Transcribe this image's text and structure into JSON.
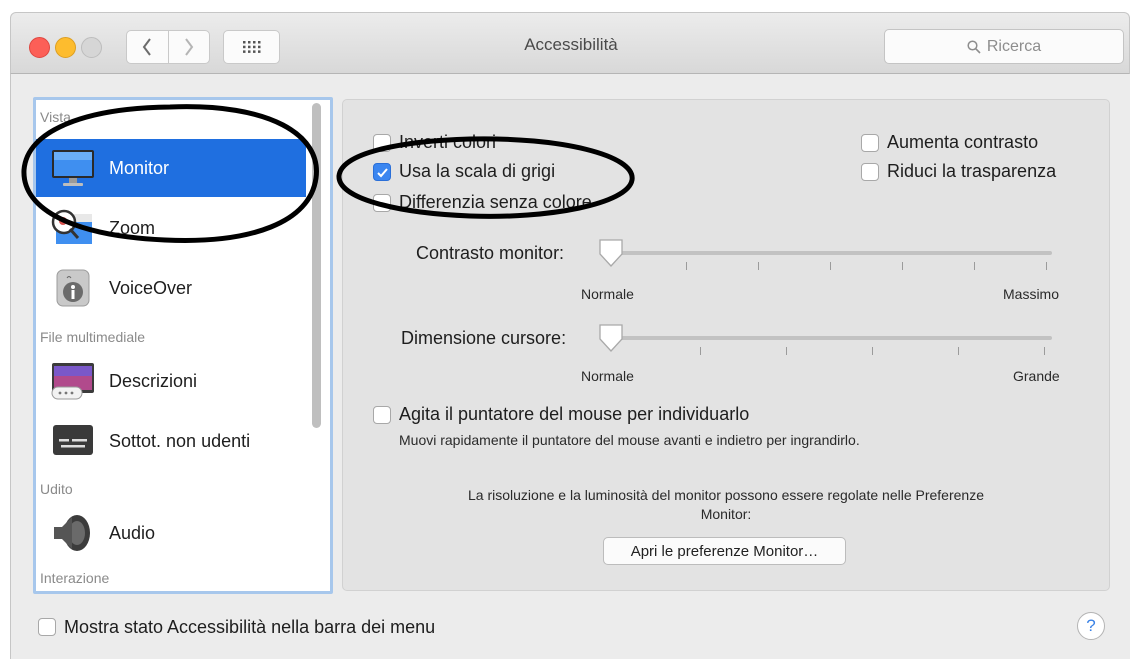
{
  "window": {
    "title": "Accessibilità"
  },
  "toolbar": {
    "search_placeholder": "Ricerca",
    "back_icon": "chevron-left-icon",
    "forward_icon": "chevron-right-icon",
    "grid_icon": "show-all-grid-icon"
  },
  "sidebar": {
    "sections": {
      "vista": "Vista",
      "media": "File multimediale",
      "udito": "Udito",
      "interazione": "Interazione"
    },
    "items": [
      {
        "label": "Monitor",
        "icon": "monitor-icon",
        "selected": true
      },
      {
        "label": "Zoom",
        "icon": "zoom-icon",
        "selected": false
      },
      {
        "label": "VoiceOver",
        "icon": "voiceover-icon",
        "selected": false
      },
      {
        "label": "Descrizioni",
        "icon": "descriptions-icon",
        "selected": false
      },
      {
        "label": "Sottot. non udenti",
        "icon": "captions-icon",
        "selected": false
      },
      {
        "label": "Audio",
        "icon": "speaker-icon",
        "selected": false
      }
    ]
  },
  "main": {
    "checkboxes": {
      "invert": {
        "label": "Inverti colori",
        "checked": false
      },
      "grayscale": {
        "label": "Usa la scala di grigi",
        "checked": true
      },
      "differentiate": {
        "label": "Differenzia senza colore",
        "checked": false
      },
      "contrast": {
        "label": "Aumenta contrasto",
        "checked": false
      },
      "transparency": {
        "label": "Riduci la trasparenza",
        "checked": false
      }
    },
    "contrast_slider": {
      "label": "Contrasto monitor:",
      "min_label": "Normale",
      "max_label": "Massimo",
      "value": 0
    },
    "cursor_slider": {
      "label": "Dimensione cursore:",
      "min_label": "Normale",
      "max_label": "Grande",
      "value": 0
    },
    "shake": {
      "label": "Agita il puntatore del mouse per individuarlo",
      "checked": false,
      "description": "Muovi rapidamente il puntatore del mouse avanti e indietro per ingrandirlo."
    },
    "info_line1": "La risoluzione e la luminosità del monitor possono essere regolate nelle Preferenze",
    "info_line2": "Monitor:",
    "open_prefs_button": "Apri le preferenze Monitor…"
  },
  "footer": {
    "menu_status": {
      "label": "Mostra stato Accessibilità nella barra dei menu",
      "checked": false
    },
    "help": "?"
  },
  "colors": {
    "selection": "#1f6fe0",
    "checkbox_on": "#3b86f0",
    "annotation": "#000000"
  }
}
